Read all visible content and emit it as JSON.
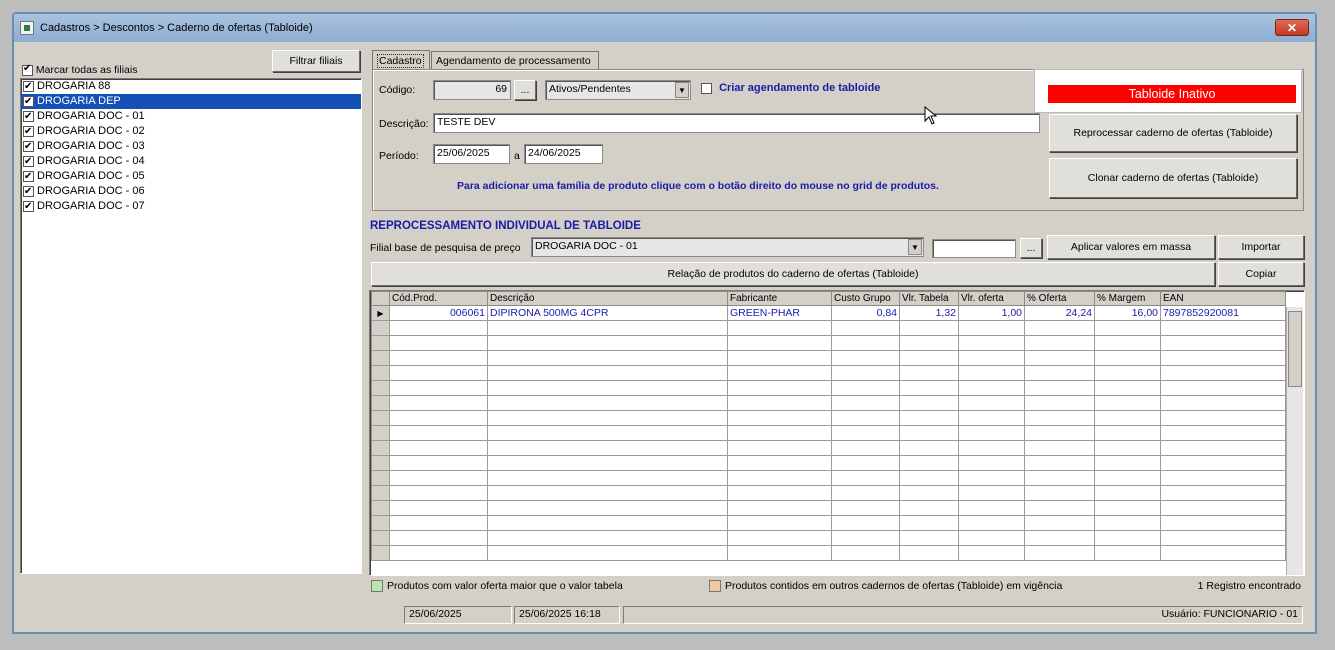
{
  "window": {
    "title": "Cadastros > Descontos > Caderno de ofertas (Tabloide)",
    "close_label": "✕"
  },
  "left": {
    "filter_button": "Filtrar filiais",
    "mark_all_label": "Marcar todas as filiais",
    "branches": [
      {
        "name": "DROGARIA 88",
        "selected": false
      },
      {
        "name": "DROGARIA DEP",
        "selected": true
      },
      {
        "name": "DROGARIA DOC - 01",
        "selected": false
      },
      {
        "name": "DROGARIA DOC - 02",
        "selected": false
      },
      {
        "name": "DROGARIA DOC - 03",
        "selected": false
      },
      {
        "name": "DROGARIA DOC - 04",
        "selected": false
      },
      {
        "name": "DROGARIA DOC - 05",
        "selected": false
      },
      {
        "name": "DROGARIA DOC - 06",
        "selected": false
      },
      {
        "name": "DROGARIA DOC - 07",
        "selected": false
      }
    ]
  },
  "tabs": {
    "cadastro": "Cadastro",
    "agendamento": "Agendamento de processamento"
  },
  "form": {
    "codigo_label": "Código:",
    "codigo_value": "69",
    "ellipsis": "...",
    "status_select": "Ativos/Pendentes",
    "criar_agendamento_label": "Criar agendamento de tabloide",
    "descricao_label": "Descrição:",
    "descricao_value": "TESTE DEV",
    "periodo_label": "Período:",
    "periodo_inicio": "25/06/2025",
    "periodo_a": "a",
    "periodo_fim": "24/06/2025",
    "hint": "Para adicionar uma família de produto clique com o botão direito do  mouse no grid de produtos."
  },
  "side": {
    "status_badge": "Tabloide Inativo",
    "status_color": "#ff0000",
    "reprocessar_button": "Reprocessar caderno de ofertas (Tabloide)",
    "clonar_button": "Clonar caderno de ofertas (Tabloide)"
  },
  "reproc": {
    "title": "REPROCESSAMENTO INDIVIDUAL DE TABLOIDE",
    "filial_label": "Filial base de pesquisa de preço",
    "filial_value": "DROGARIA DOC - 01",
    "ellipsis": "...",
    "aplicar_button": "Aplicar valores em massa",
    "importar_button": "Importar",
    "relacao_button": "Relação de produtos do caderno de ofertas (Tabloide)",
    "copiar_button": "Copiar"
  },
  "grid": {
    "columns": [
      "Cód.Prod.",
      "Descrição",
      "Fabricante",
      "Custo Grupo",
      "Vlr. Tabela",
      "Vlr. oferta",
      "% Oferta",
      "% Margem",
      "EAN"
    ],
    "rows": [
      [
        "006061",
        "DIPIRONA 500MG   4CPR",
        "GREEN-PHAR",
        "0,84",
        "1,32",
        "1,00",
        "24,24",
        "16,00",
        "7897852920081"
      ]
    ]
  },
  "legend": {
    "green_label": "Produtos com valor oferta maior que o valor tabela",
    "green_color": "#b8e6b0",
    "orange_label": "Produtos contidos em outros cadernos de ofertas (Tabloide) em vigência",
    "orange_color": "#f3c9a0",
    "record_count": "1 Registro encontrado"
  },
  "statusbar": {
    "date": "25/06/2025",
    "datetime": "25/06/2025 16:18",
    "user": "Usuário: FUNCIONARIO - 01"
  }
}
